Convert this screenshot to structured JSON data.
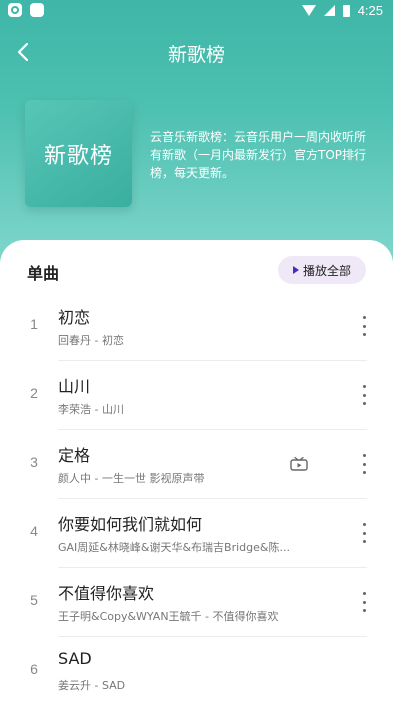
{
  "status_bar": {
    "time": "4:25"
  },
  "header": {
    "title": "新歌榜",
    "cover_text": "新歌榜",
    "description": "云音乐新歌榜：云音乐用户一周内收听所有新歌（一月内最新发行）官方TOP排行榜，每天更新。"
  },
  "section": {
    "title": "单曲",
    "play_all_label": "播放全部"
  },
  "songs": [
    {
      "rank": "1",
      "title": "初恋",
      "subtitle": "回春丹 - 初恋"
    },
    {
      "rank": "2",
      "title": "山川",
      "subtitle": "李荣浩 - 山川"
    },
    {
      "rank": "3",
      "title": "定格",
      "subtitle": "颜人中 - 一生一世 影视原声带"
    },
    {
      "rank": "4",
      "title": "你要如何我们就如何",
      "subtitle": "GAI周延&林晓峰&谢天华&布瑞吉Bridge&陈..."
    },
    {
      "rank": "5",
      "title": "不值得你喜欢",
      "subtitle": "王子明&Copy&WYAN王毓千 - 不值得你喜欢"
    },
    {
      "rank": "6",
      "title": "SAD",
      "subtitle": "姜云升 - SAD"
    }
  ],
  "icons": {
    "back": "chevron-left-icon",
    "play": "play-icon",
    "more": "more-vertical-icon",
    "mv": "tv-icon"
  },
  "colors": {
    "header": "#4cc0b1",
    "play_accent": "#4b2bbd",
    "play_bg": "#efe9f7"
  }
}
